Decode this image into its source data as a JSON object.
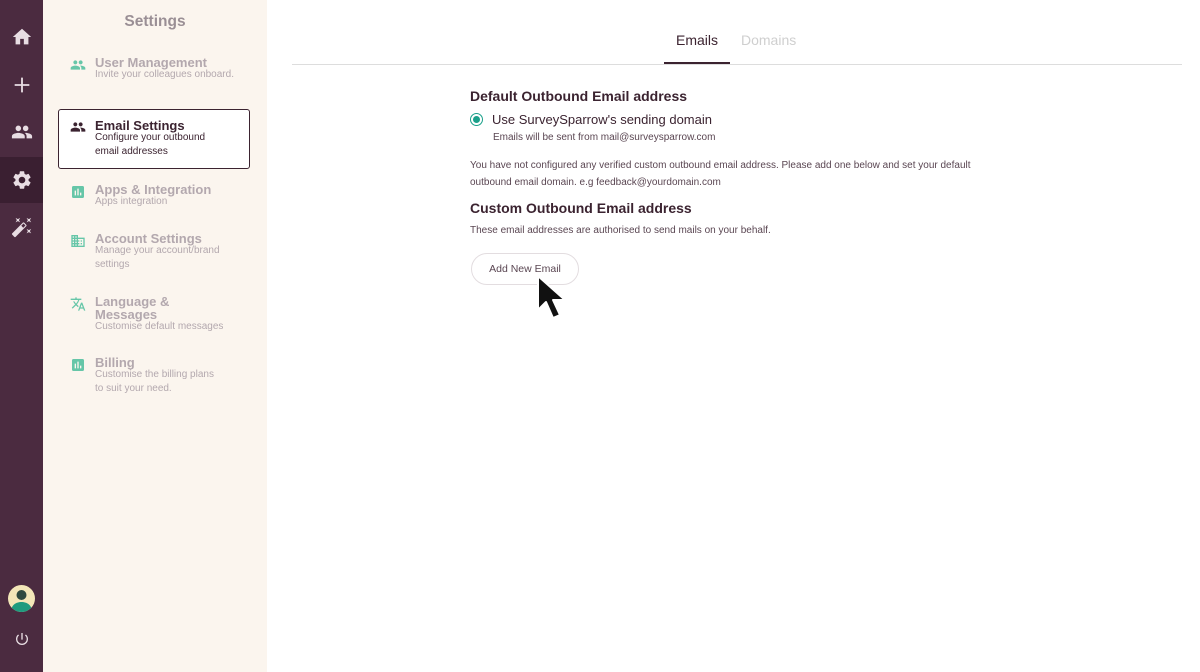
{
  "rail": {
    "items": [
      {
        "name": "home-icon"
      },
      {
        "name": "plus-icon"
      },
      {
        "name": "people-icon"
      },
      {
        "name": "gear-icon"
      },
      {
        "name": "magic-wand-icon"
      }
    ],
    "active": "gear-icon"
  },
  "sidebar": {
    "title": "Settings",
    "items": [
      {
        "label": "User Management",
        "desc": "Invite your colleagues onboard.",
        "icon": "people-icon"
      },
      {
        "label": "Email Settings",
        "desc": "Configure your outbound email addresses",
        "icon": "people-icon"
      },
      {
        "label": "Apps & Integration",
        "desc": "Apps integration",
        "icon": "bar-chart-icon"
      },
      {
        "label": "Account Settings",
        "desc": "Manage your account/brand settings",
        "icon": "building-icon"
      },
      {
        "label": "Language & Messages",
        "desc": "Customise default messages",
        "icon": "translate-icon"
      },
      {
        "label": "Billing",
        "desc": "Customise the billing plans to suit your need.",
        "icon": "bar-chart-icon"
      }
    ],
    "active_index": 1
  },
  "tabs": [
    {
      "label": "Emails",
      "active": true
    },
    {
      "label": "Domains",
      "active": false
    }
  ],
  "content": {
    "default_heading": "Default Outbound Email address",
    "radio_label": "Use SurveySparrow's sending domain",
    "radio_selected": true,
    "radio_sub": "Emails will be sent from mail@surveysparrow.com",
    "notice": "You have not configured any verified custom outbound email address. Please add one below and set your default outbound email domain. e.g feedback@yourdomain.com",
    "custom_heading": "Custom Outbound Email address",
    "custom_desc": "These email addresses are authorised to send mails on your behalf.",
    "add_button": "Add New Email"
  },
  "colors": {
    "rail_bg": "#4b2b40",
    "sidebar_bg": "#fbf5ee",
    "accent_dark": "#3b2330",
    "radio_green": "#1aa08a",
    "icon_green": "#66c6a8"
  }
}
